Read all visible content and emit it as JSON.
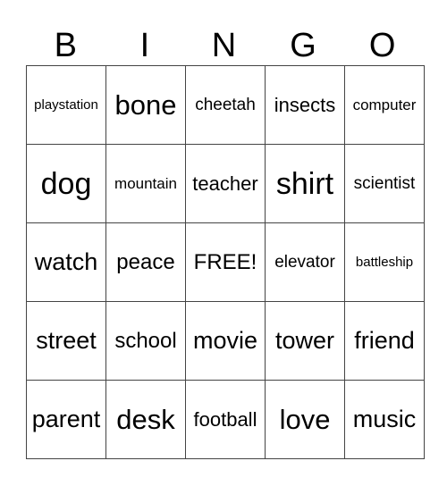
{
  "card": {
    "header": [
      "B",
      "I",
      "N",
      "G",
      "O"
    ],
    "rows": [
      [
        "playstation",
        "bone",
        "cheetah",
        "insects",
        "computer"
      ],
      [
        "dog",
        "mountain",
        "teacher",
        "shirt",
        "scientist"
      ],
      [
        "watch",
        "peace",
        "FREE!",
        "elevator",
        "battleship"
      ],
      [
        "street",
        "school",
        "movie",
        "tower",
        "friend"
      ],
      [
        "parent",
        "desk",
        "football",
        "love",
        "music"
      ]
    ]
  }
}
